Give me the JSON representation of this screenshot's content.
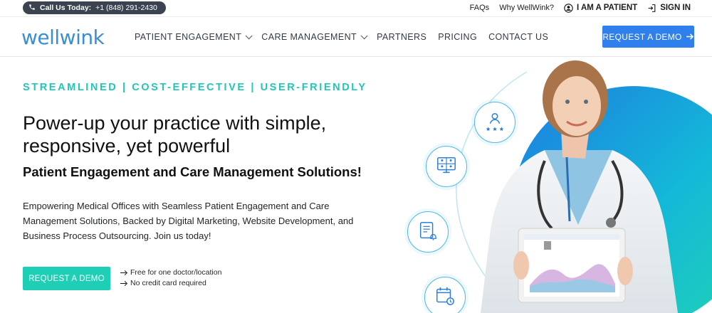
{
  "topbar": {
    "call_label": "Call Us Today:",
    "call_number": "+1 (848) 291-2430",
    "faqs": "FAQs",
    "why": "Why WellWink?",
    "patient": "I AM A PATIENT",
    "signin": "SIGN IN"
  },
  "nav": {
    "logo": "wellwink",
    "items": [
      "PATIENT ENGAGEMENT",
      "CARE MANAGEMENT",
      "PARTNERS",
      "PRICING",
      "CONTACT US"
    ],
    "demo_button": "REQUEST A DEMO"
  },
  "hero": {
    "tagline": "STREAMLINED | COST-EFFECTIVE | USER-FRIENDLY",
    "headline": "Power-up your practice with simple, responsive, yet powerful",
    "subheadline": "Patient Engagement and Care Management Solutions!",
    "body": "Empowering Medical Offices with Seamless Patient Engagement and Care Management Solutions, Backed by Digital Marketing, Website Development, and Business Process Outsourcing. Join us today!",
    "cta": "REQUEST A DEMO",
    "perks": [
      "Free for one doctor/location",
      "No credit card required"
    ]
  },
  "colors": {
    "brand_blue": "#2f80ed",
    "teal": "#1fcfb5",
    "logo_blue": "#3a8fd0",
    "pill_dark": "#3b4350"
  },
  "icons": [
    "phone-icon",
    "user-circle-icon",
    "sign-in-icon",
    "chevron-down-icon",
    "arrow-right-icon",
    "ratings-icon",
    "video-grid-icon",
    "checklist-bell-icon",
    "calendar-clock-icon"
  ]
}
